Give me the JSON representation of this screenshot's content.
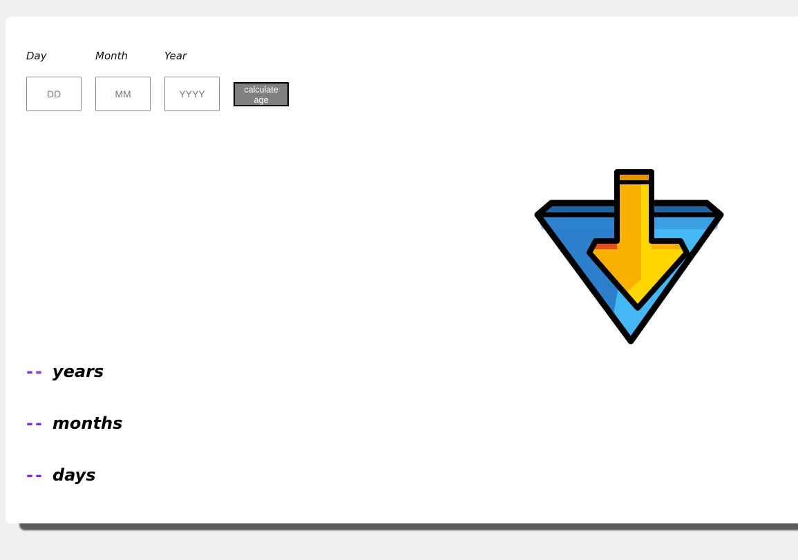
{
  "form": {
    "day": {
      "label": "Day",
      "placeholder": "DD",
      "value": ""
    },
    "month": {
      "label": "Month",
      "placeholder": "MM",
      "value": ""
    },
    "year": {
      "label": "Year",
      "placeholder": "YYYY",
      "value": ""
    },
    "calculate_label": "calculate age"
  },
  "results": {
    "years": {
      "value": "--",
      "unit": "years"
    },
    "months": {
      "value": "--",
      "unit": "months"
    },
    "days": {
      "value": "--",
      "unit": "days"
    }
  },
  "illustration": {
    "icon": "download-arrow-icon",
    "colors": {
      "blue_light": "#44b8f5",
      "blue_dark": "#2c7fcb",
      "arrow_yellow": "#ffd500",
      "arrow_orange": "#f9b000",
      "accent_red": "#e8501a"
    }
  },
  "accent_color": "#8a2be2"
}
